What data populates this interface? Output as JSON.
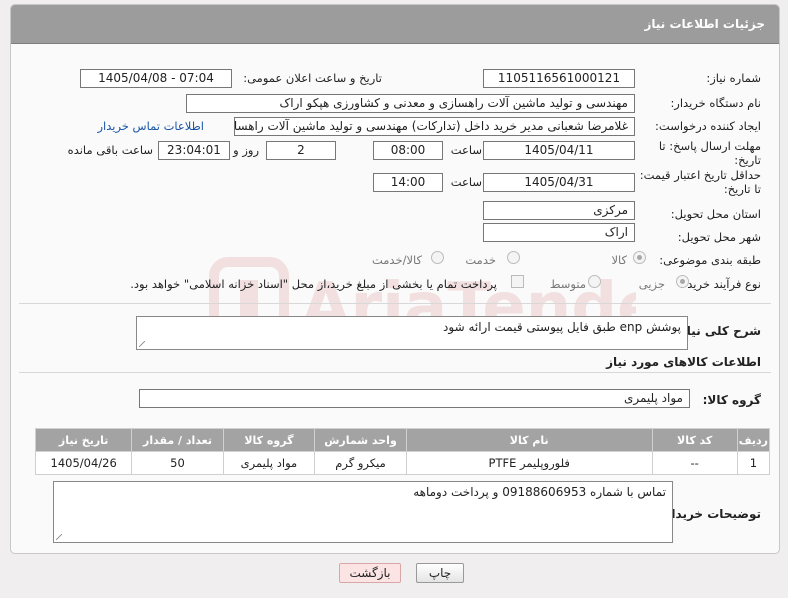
{
  "header": {
    "title": "جزئیات اطلاعات نیاز"
  },
  "form": {
    "need_number_label": "شماره نیاز:",
    "need_number": "1105116561000121",
    "announce_label": "تاریخ و ساعت اعلان عمومی:",
    "announce_value": "1405/04/08 - 07:04",
    "buyer_org_label": "نام دستگاه خریدار:",
    "buyer_org": "مهندسی و تولید ماشین آلات راهسازی و معدنی و کشاورزی هپکو اراک",
    "creator_label": "ایجاد کننده درخواست:",
    "creator": "غلامرضا شعبانی مدیر خرید داخل (تدارکات) مهندسی و تولید ماشین آلات راهسازی",
    "contact_link": "اطلاعات تماس خریدار",
    "deadline_label_1": "مهلت ارسال پاسخ: تا",
    "deadline_label_2": "تاریخ:",
    "deadline_date": "1405/04/11",
    "time_label": "ساعت",
    "deadline_time": "08:00",
    "days_value": "2",
    "days_label": "روز و",
    "remaining_value": "23:04:01",
    "remaining_label": "ساعت باقی مانده",
    "price_validity_label_1": "حداقل تاریخ اعتبار قیمت:",
    "price_validity_label_2": "تا تاریخ:",
    "price_validity_date": "1405/04/31",
    "price_validity_time": "14:00",
    "province_label": "استان محل تحویل:",
    "province": "مرکزی",
    "city_label": "شهر محل تحویل:",
    "city": "اراک",
    "category_label": "طبقه بندی موضوعی:",
    "category_options": [
      "کالا",
      "خدمت",
      "کالا/خدمت"
    ],
    "process_label": "نوع فرآیند خرید :",
    "process_options": [
      "جزیی",
      "متوسط"
    ],
    "payment_note": "پرداخت تمام یا بخشی از مبلغ خرید،از محل \"اسناد خزانه اسلامی\" خواهد بود."
  },
  "description": {
    "label": "شرح کلی نیاز:",
    "text": "پوشش enp طبق فایل پیوستی قیمت ارائه شود"
  },
  "goods": {
    "section_title": "اطلاعات کالاهای مورد نیاز",
    "group_label": "گروه کالا:",
    "group_value": "مواد پلیمری",
    "columns": [
      "ردیف",
      "کد کالا",
      "نام کالا",
      "واحد شمارش",
      "گروه کالا",
      "تعداد / مقدار",
      "تاریخ نیاز"
    ],
    "rows": [
      [
        "1",
        "--",
        "فلوروپلیمر PTFE",
        "میکرو گرم",
        "مواد پلیمری",
        "50",
        "1405/04/26"
      ]
    ]
  },
  "buyer_notes": {
    "label": "توضیحات خریدار:",
    "text": "تماس با شماره 09188606953 و پرداخت دوماهه"
  },
  "buttons": {
    "print": "چاپ",
    "back": "بازگشت"
  },
  "watermark_text": "AriaTender.net",
  "colors": {
    "header": "#9c9c9c",
    "table_header": "#a3a3a3",
    "link": "#1a55a8",
    "watermark": "#c03030"
  }
}
